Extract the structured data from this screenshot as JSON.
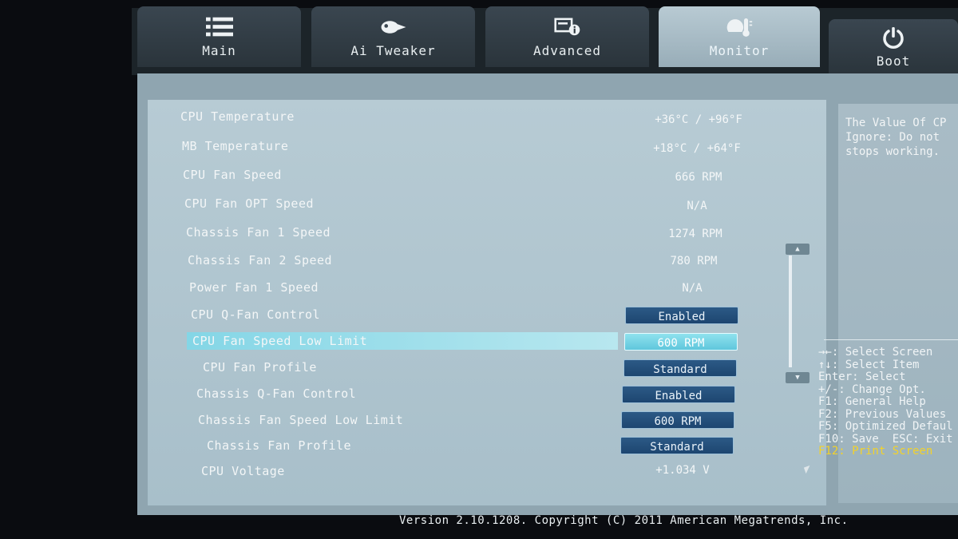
{
  "tabs": [
    {
      "label": "Main",
      "icon": "list-icon"
    },
    {
      "label": "Ai Tweaker",
      "icon": "rocket-icon"
    },
    {
      "label": "Advanced",
      "icon": "info-window-icon"
    },
    {
      "label": "Monitor",
      "icon": "thermometer-icon",
      "active": true
    },
    {
      "label": "Boot",
      "icon": "power-icon"
    }
  ],
  "rows": [
    {
      "label": "CPU Temperature",
      "value": "+36°C / +96°F"
    },
    {
      "label": "MB Temperature",
      "value": "+18°C / +64°F"
    },
    {
      "label": "CPU Fan Speed",
      "value": "666 RPM"
    },
    {
      "label": "CPU Fan OPT Speed",
      "value": "N/A"
    },
    {
      "label": "Chassis Fan 1 Speed",
      "value": "1274 RPM"
    },
    {
      "label": "Chassis Fan 2 Speed",
      "value": "780 RPM"
    },
    {
      "label": "Power Fan 1 Speed",
      "value": "N/A"
    },
    {
      "label": "CPU Q-Fan Control",
      "value": "Enabled"
    },
    {
      "label": "CPU Fan Speed Low Limit",
      "value": "600 RPM"
    },
    {
      "label": "CPU Fan Profile",
      "value": "Standard"
    },
    {
      "label": "Chassis Q-Fan Control",
      "value": "Enabled"
    },
    {
      "label": "Chassis Fan Speed Low Limit",
      "value": "600 RPM"
    },
    {
      "label": "Chassis Fan Profile",
      "value": "Standard"
    },
    {
      "label": "CPU Voltage",
      "value": "+1.034 V"
    }
  ],
  "help": {
    "text": "The Value Of CP\nIgnore: Do not\nstops working."
  },
  "keys": {
    "select_screen": "→←: Select Screen",
    "select_item": "↑↓: Select Item",
    "enter": "Enter: Select",
    "change": "+/-: Change Opt.",
    "f1": "F1: General Help",
    "f2": "F2: Previous Values",
    "f5": "F5: Optimized Defaul",
    "f10": "F10: Save  ESC: Exit",
    "f12": "F12: Print Screen"
  },
  "footer": {
    "version": "Version 2.10.1208. Copyright (C) 2011 American Megatrends, Inc."
  },
  "colors": {
    "accent": "#1d4670",
    "highlight": "#7fd8e8",
    "f12": "#f3d22a"
  }
}
